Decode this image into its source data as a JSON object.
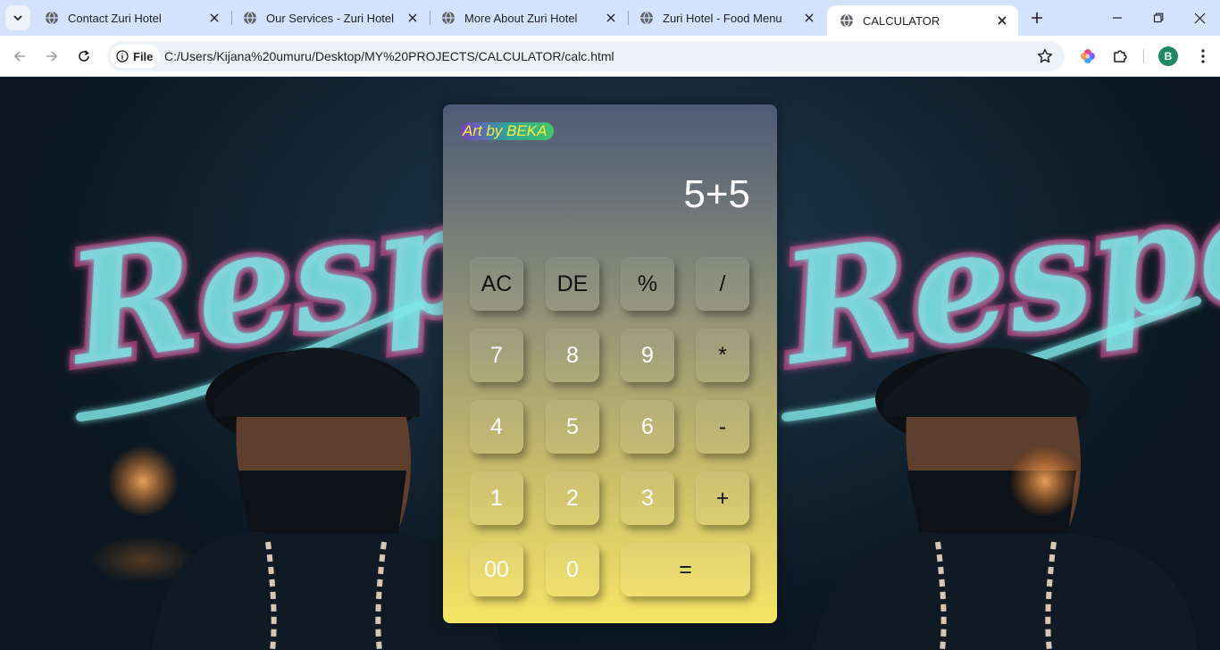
{
  "browser": {
    "tabs": [
      {
        "label": "Contact Zuri Hotel",
        "active": false
      },
      {
        "label": "Our Services - Zuri Hotel",
        "active": false
      },
      {
        "label": "More About Zuri Hotel",
        "active": false
      },
      {
        "label": "Zuri Hotel - Food Menu",
        "active": false
      },
      {
        "label": "CALCULATOR",
        "active": true
      }
    ],
    "security_chip": "File",
    "url": "C:/Users/Kijana%20umuru/Desktop/MY%20PROJECTS/CALCULATOR/calc.html",
    "profile_initial": "B"
  },
  "background": {
    "neon_word": "Respect",
    "neon_color": "#7fe6e6"
  },
  "calculator": {
    "brand_label": "Art by BEKA",
    "display_value": "5+5",
    "keys": {
      "ac": "AC",
      "de": "DE",
      "percent": "%",
      "divide": "/",
      "seven": "7",
      "eight": "8",
      "nine": "9",
      "multiply": "*",
      "four": "4",
      "five": "5",
      "six": "6",
      "minus": "-",
      "one": "1",
      "two": "2",
      "three": "3",
      "plus": "+",
      "double_zero": "00",
      "zero": "0",
      "equals": "="
    },
    "colors": {
      "top": "#4d5b77",
      "bottom": "#f7e566",
      "brand_text": "#ffeb3b"
    }
  }
}
